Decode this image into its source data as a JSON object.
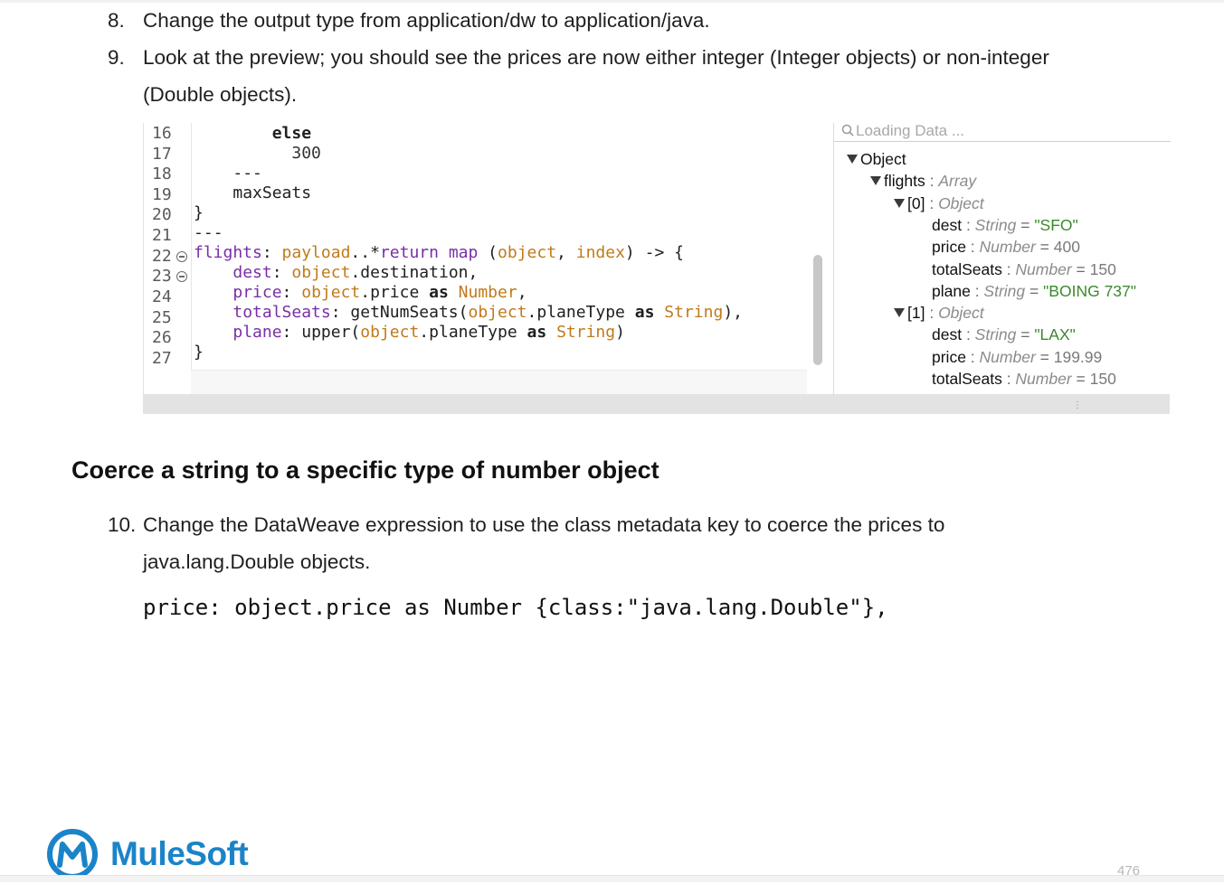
{
  "steps": [
    {
      "num": "8.",
      "lines": [
        "Change the output type from application/dw to application/java."
      ]
    },
    {
      "num": "9.",
      "lines": [
        "Look at the preview; you should see the prices are now either integer (Integer objects) or non-integer",
        "(Double objects)."
      ]
    },
    {
      "num": "10.",
      "lines": [
        "Change the DataWeave expression to use the class metadata key to coerce the prices to",
        "java.lang.Double objects."
      ]
    }
  ],
  "editor": {
    "line_numbers": [
      "16",
      "17",
      "18",
      "19",
      "20",
      "21",
      "22",
      "23",
      "24",
      "25",
      "26",
      "27"
    ],
    "fold_markers_on": [
      "22",
      "23"
    ],
    "code_lines": [
      "else",
      "300",
      "---",
      "maxSeats",
      "}",
      "---",
      "flights: payload..*return map (object, index) -> {",
      "dest: object.destination,",
      "price: object.price as Number,",
      "totalSeats: getNumSeats(object.planeType as String),",
      "plane: upper(object.planeType as String)",
      "}"
    ]
  },
  "preview": {
    "loading_text": "Loading Data ...",
    "tree": [
      {
        "label": "Object"
      },
      {
        "label": "flights",
        "type": "Array"
      },
      {
        "label": "[0]",
        "type": "Object"
      },
      {
        "label": "dest",
        "type": "String",
        "value": "\"SFO\""
      },
      {
        "label": "price",
        "type": "Number",
        "value": "400"
      },
      {
        "label": "totalSeats",
        "type": "Number",
        "value": "150"
      },
      {
        "label": "plane",
        "type": "String",
        "value": "\"BOING 737\""
      },
      {
        "label": "[1]",
        "type": "Object"
      },
      {
        "label": "dest",
        "type": "String",
        "value": "\"LAX\""
      },
      {
        "label": "price",
        "type": "Number",
        "value": "199.99"
      },
      {
        "label": "totalSeats",
        "type": "Number",
        "value": "150"
      }
    ],
    "colon": ":",
    "equals": "="
  },
  "heading": "Coerce a string to a specific type of number object",
  "code_example": "price: object.price as Number {class:\"java.lang.Double\"},",
  "footer": {
    "logo_text": "MuleSoft",
    "page_number": "476"
  },
  "colors": {
    "brand_blue": "#1b84c8",
    "keyword": "#7f0055",
    "identifier": "#7a2ea6",
    "orange": "#c17a1a",
    "string_value": "#3a8a2a"
  }
}
